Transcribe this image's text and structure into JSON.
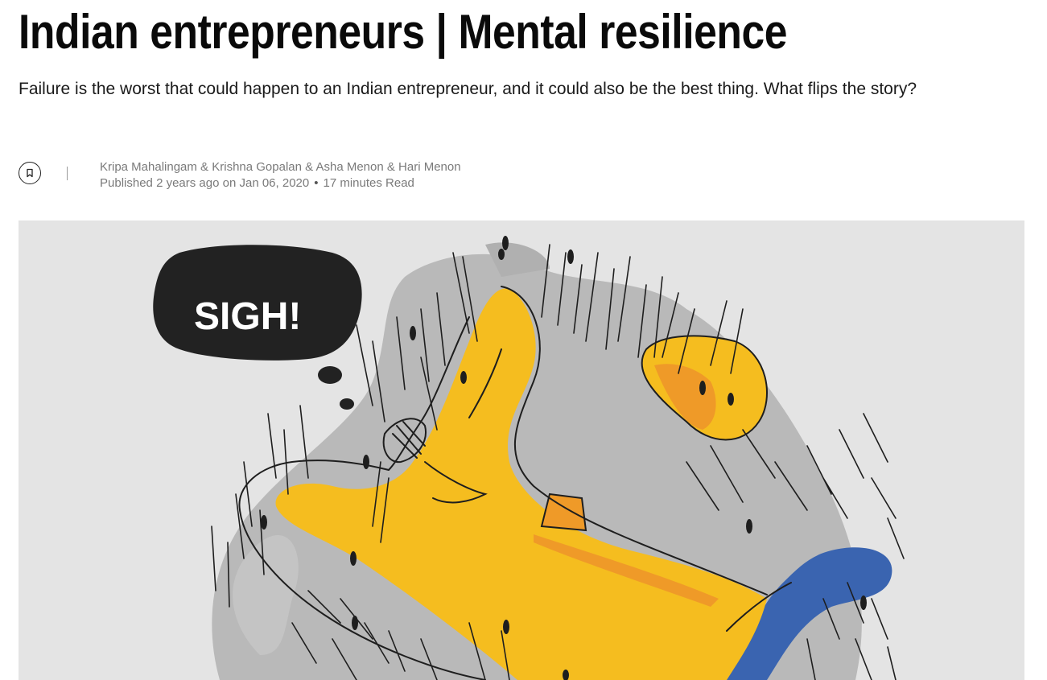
{
  "article": {
    "headline": "Indian entrepreneurs | Mental resilience",
    "dek": "Failure is the worst that could happen to an Indian entrepreneur, and it could also be the best thing. What flips the story?",
    "authors": "Kripa Mahalingam & Krishna Gopalan & Asha Menon & Hari Menon",
    "published_prefix": "Published",
    "relative_time": "2 years ago",
    "date_prefix": "on",
    "date": "Jan 06, 2020",
    "separator": "•",
    "read_time": "17 minutes Read"
  },
  "actions": {
    "bookmark_icon": "bookmark-icon"
  },
  "hero": {
    "speech_text": "SIGH!",
    "colors": {
      "background": "#e4e4e4",
      "shadow": "#b8b8b8",
      "yellow": "#f5bd1f",
      "orange": "#ef9a28",
      "river": "#3a64b0",
      "ink": "#1e1e1e"
    }
  }
}
